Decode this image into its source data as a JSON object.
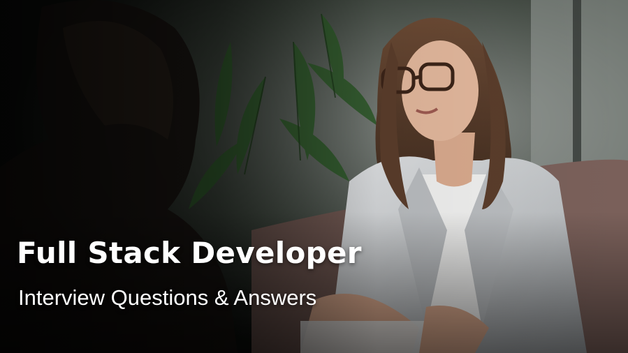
{
  "banner": {
    "title": "Full Stack Developer",
    "subtitle": "Interview Questions & Answers"
  },
  "photo": {
    "icon": "interview-photo-icon"
  },
  "colors": {
    "text": "#ffffff",
    "plant": "#2f5a2a",
    "blazer": "#c9cbcd",
    "sofa": "#6e5650"
  }
}
